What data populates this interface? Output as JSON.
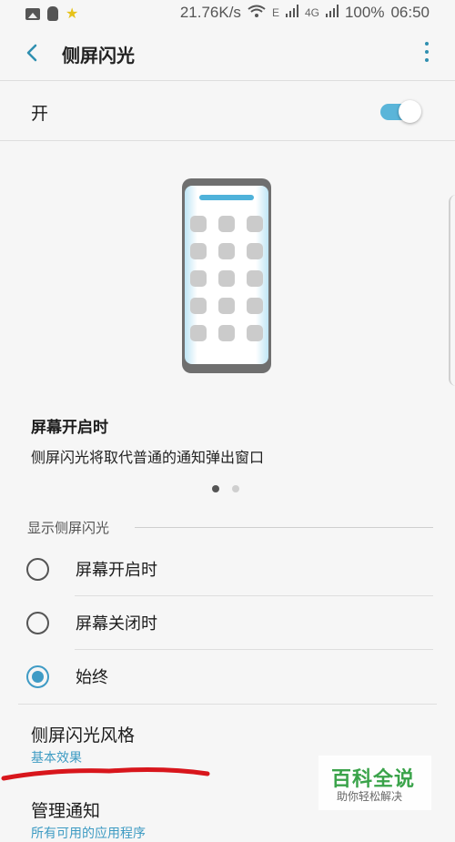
{
  "status_bar": {
    "speed": "21.76K/s",
    "signal_labels": [
      "E",
      "4G"
    ],
    "battery": "100%",
    "time": "06:50"
  },
  "app_bar": {
    "title": "侧屏闪光"
  },
  "master_switch": {
    "label": "开",
    "state": "on"
  },
  "preview": {
    "title": "屏幕开启时",
    "description": "侧屏闪光将取代普通的通知弹出窗口",
    "page_count": 2,
    "current_page": 1
  },
  "display_section": {
    "header": "显示侧屏闪光",
    "options": [
      {
        "label": "屏幕开启时",
        "selected": false
      },
      {
        "label": "屏幕关闭时",
        "selected": false
      },
      {
        "label": "始终",
        "selected": true
      }
    ]
  },
  "style_item": {
    "title": "侧屏闪光风格",
    "subtitle": "基本效果"
  },
  "manage_item": {
    "title": "管理通知",
    "subtitle": "所有可用的应用程序"
  },
  "watermark": {
    "main": "百科全说",
    "sub": "助你轻松解决"
  },
  "colors": {
    "accent": "#3f9bc5",
    "toggle_on": "#5ab5d9",
    "annotation_red": "#d8161c",
    "watermark_green": "#3aa34a"
  }
}
